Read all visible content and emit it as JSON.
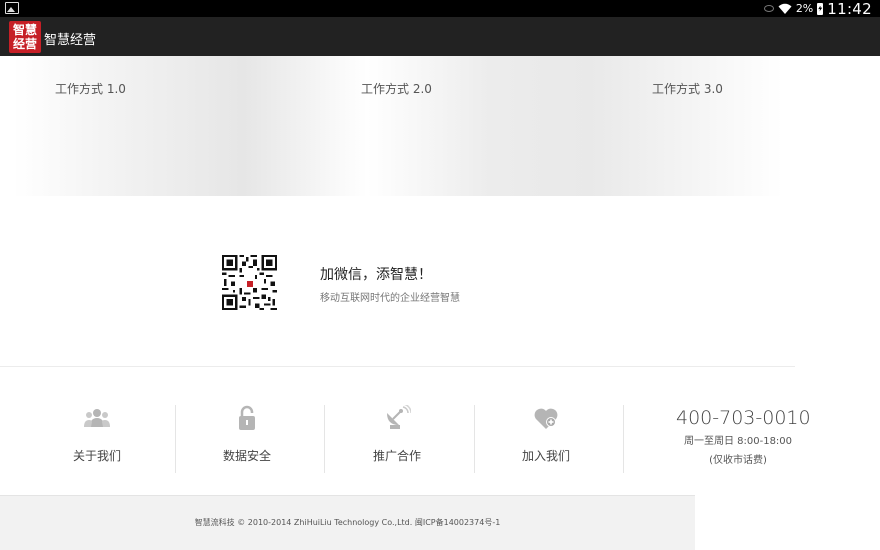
{
  "status_bar": {
    "battery_percent": "2%",
    "time": "11:42"
  },
  "app": {
    "logo_text_line1": "智慧",
    "logo_text_line2": "经营",
    "title": "智慧经营"
  },
  "banner": {
    "tabs": [
      {
        "label": "工作方式 1.0"
      },
      {
        "label": "工作方式 2.0"
      },
      {
        "label": "工作方式 3.0"
      }
    ]
  },
  "wechat": {
    "title": "加微信，添智慧！",
    "subtitle": "移动互联网时代的企业经营智慧"
  },
  "features": [
    {
      "label": "关于我们",
      "icon": "users-icon"
    },
    {
      "label": "数据安全",
      "icon": "lock-icon"
    },
    {
      "label": "推广合作",
      "icon": "satellite-dish-icon"
    },
    {
      "label": "加入我们",
      "icon": "heart-plus-icon"
    }
  ],
  "contact": {
    "phone": "400-703-0010",
    "hours": "周一至周日 8:00-18:00",
    "note": "(仅收市话费)"
  },
  "footer": {
    "copyright": "智慧流科技 © 2010-2014 ZhiHuiLiu Technology Co.,Ltd. 闽ICP备14002374号-1"
  },
  "colors": {
    "brand_red": "#c61f26",
    "action_bar": "#222222",
    "icon_gray": "#b5b5b5"
  }
}
